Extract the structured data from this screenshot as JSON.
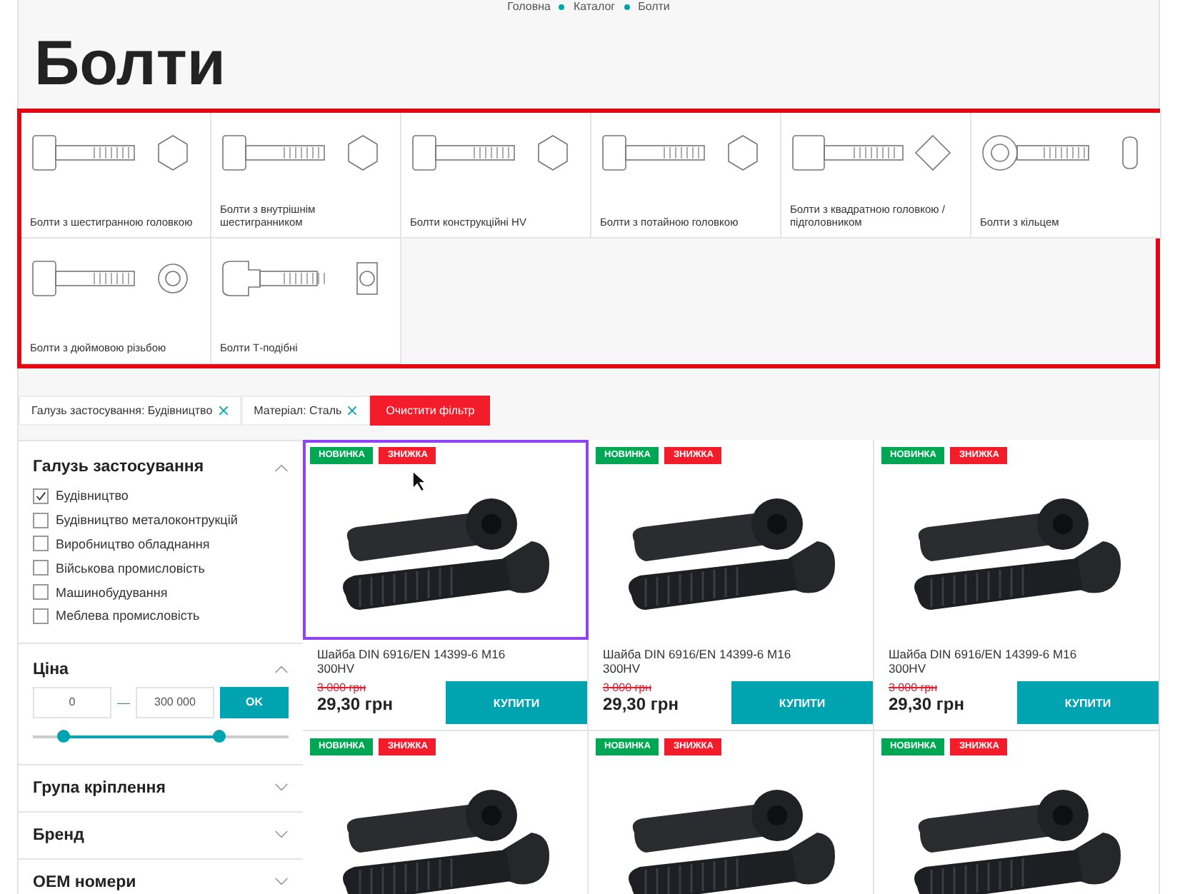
{
  "breadcrumb": [
    "Головна",
    "Каталог",
    "Болти"
  ],
  "title": "Болти",
  "categories": [
    {
      "label": "Болти з шестигранною головкою",
      "kind": "hex"
    },
    {
      "label": "Болти з внутрішнім шестигранником",
      "kind": "hex"
    },
    {
      "label": "Болти конструкційні HV",
      "kind": "hex"
    },
    {
      "label": "Болти з потайною головкою",
      "kind": "hex"
    },
    {
      "label": "Болти з квадратною головкою / підголовником",
      "kind": "square"
    },
    {
      "label": "Болти з кільцем",
      "kind": "ring"
    },
    {
      "label": "Болти з дюймовою різьбою",
      "kind": "round"
    },
    {
      "label": "Болти Т-подібні",
      "kind": "tee"
    }
  ],
  "active_filters": [
    {
      "label": "Галузь застосування: Будівництво"
    },
    {
      "label": "Матеріал: Сталь"
    }
  ],
  "clear_filter": "Очистити фільтр",
  "sidebar": {
    "application": {
      "title": "Галузь застосування",
      "expanded": true,
      "options": [
        {
          "label": "Будівництво",
          "checked": true
        },
        {
          "label": "Будівництво металоконтрукцій",
          "checked": false
        },
        {
          "label": "Виробництво обладнання",
          "checked": false
        },
        {
          "label": "Військова промисловість",
          "checked": false
        },
        {
          "label": "Машинобудування",
          "checked": false
        },
        {
          "label": "Меблева промисловість",
          "checked": false
        }
      ]
    },
    "price": {
      "title": "Ціна",
      "expanded": true,
      "min": "0",
      "separator": "—",
      "max": "300 000",
      "ok": "OK",
      "thumbs": [
        {
          "level": 0.12
        },
        {
          "level": 0.73
        }
      ]
    },
    "sections": [
      {
        "title": "Група кріплення",
        "expanded": false
      },
      {
        "title": "Бренд",
        "expanded": false
      },
      {
        "title": "OEM номери",
        "expanded": false
      }
    ]
  },
  "products": [
    {
      "selected": true,
      "badges": [
        {
          "label": "НОВИНКА",
          "color": "#00a651"
        },
        {
          "label": "ЗНИЖКА",
          "color": "#f21c2a"
        }
      ],
      "name": "Шайба DIN 6916/EN 14399-6 M16 300HV",
      "old_price": "3 000 грн",
      "price": "29,30 грн",
      "buy": "КУПИТИ"
    },
    {
      "selected": false,
      "badges": [
        {
          "label": "НОВИНКА",
          "color": "#00a651"
        },
        {
          "label": "ЗНИЖКА",
          "color": "#f21c2a"
        }
      ],
      "name": "Шайба DIN 6916/EN 14399-6 M16 300HV",
      "old_price": "3 000 грн",
      "price": "29,30 грн",
      "buy": "КУПИТИ"
    },
    {
      "selected": false,
      "badges": [
        {
          "label": "НОВИНКА",
          "color": "#00a651"
        },
        {
          "label": "ЗНИЖКА",
          "color": "#f21c2a"
        }
      ],
      "name": "Шайба DIN 6916/EN 14399-6 M16 300HV",
      "old_price": "3 000 грн",
      "price": "29,30 грн",
      "buy": "КУПИТИ"
    },
    {
      "selected": false,
      "badges": [
        {
          "label": "НОВИНКА",
          "color": "#00a651"
        },
        {
          "label": "ЗНИЖКА",
          "color": "#f21c2a"
        }
      ]
    },
    {
      "selected": false,
      "badges": [
        {
          "label": "НОВИНКА",
          "color": "#00a651"
        },
        {
          "label": "ЗНИЖКА",
          "color": "#f21c2a"
        }
      ]
    },
    {
      "selected": false,
      "badges": [
        {
          "label": "НОВИНКА",
          "color": "#00a651"
        },
        {
          "label": "ЗНИЖКА",
          "color": "#f21c2a"
        }
      ]
    }
  ]
}
